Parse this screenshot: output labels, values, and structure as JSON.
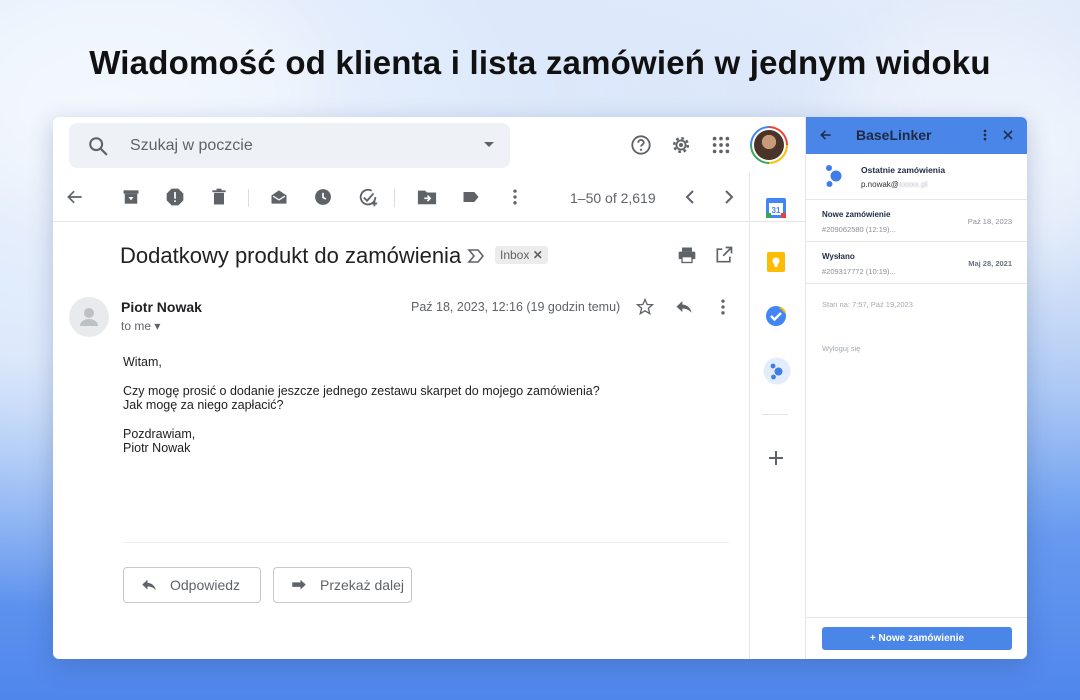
{
  "headline": "Wiadomość od klienta i lista zamówień w jednym widoku",
  "search": {
    "placeholder": "Szukaj w poczcie"
  },
  "toolbar": {
    "count": "1–50 of 2,619"
  },
  "email": {
    "subject": "Dodatkowy produkt do zamówienia",
    "label": "Inbox",
    "sender": "Piotr Nowak",
    "to": "to me",
    "date": "Paź 18, 2023, 12:16",
    "relative": "(19 godzin temu)",
    "body": {
      "greeting": "Witam,",
      "line1": "Czy mogę prosić o dodanie jeszcze jednego zestawu skarpet do mojego zamówienia?",
      "line2": "Jak mogę za niego zapłacić?",
      "closing": "Pozdrawiam,",
      "signature": "Piotr Nowak"
    },
    "reply_label": "Odpowiedz",
    "forward_label": "Przekaż dalej"
  },
  "panel": {
    "title": "BaseLinker",
    "recent_title": "Ostatnie zamówienia",
    "email_prefix": "p.nowak@",
    "email_hidden": "xxxxx.pl",
    "orders": [
      {
        "status": "Nowe zamówienie",
        "number": "#209062580 (12:19)...",
        "date": "Paź 18, 2023"
      },
      {
        "status": "Wysłano",
        "number": "#209317772 (10:19)...",
        "date": "Maj 28, 2021"
      }
    ],
    "state": "Stan na: 7:57, Paź 19,2023",
    "logout": "Wyloguj się",
    "new_order": "+ Nowe zamówienie"
  },
  "colors": {
    "panel_accent": "#4a86e8",
    "brand_logo": "#3f7ee8"
  }
}
